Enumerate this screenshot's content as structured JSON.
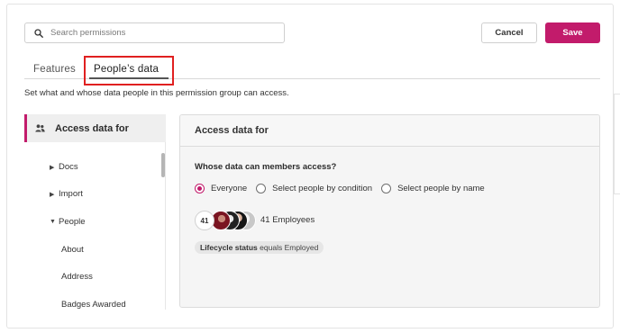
{
  "search": {
    "placeholder": "Search permissions"
  },
  "actions": {
    "cancel_label": "Cancel",
    "save_label": "Save"
  },
  "tabs": [
    {
      "label": "Features",
      "active": false
    },
    {
      "label": "People’s data",
      "active": true
    }
  ],
  "description": "Set what and whose data people in this permission group can access.",
  "sidebar": {
    "active_item": {
      "label": "Access data for",
      "icon": "people-icon"
    },
    "items": [
      {
        "label": "Docs",
        "caret": "right"
      },
      {
        "label": "Import",
        "caret": "right"
      },
      {
        "label": "People",
        "caret": "down"
      },
      {
        "label": "About",
        "caret": ""
      },
      {
        "label": "Address",
        "caret": ""
      },
      {
        "label": "Badges Awarded",
        "caret": ""
      }
    ]
  },
  "panel": {
    "title": "Access data for",
    "question": "Whose data can members access?",
    "options": [
      {
        "label": "Everyone",
        "selected": true
      },
      {
        "label": "Select people by condition",
        "selected": false
      },
      {
        "label": "Select people by name",
        "selected": false
      }
    ],
    "avatar_count": "41",
    "employees_label": "41 Employees",
    "filter": {
      "field": "Lifecycle status",
      "rest": "equals Employed"
    }
  },
  "colors": {
    "accent": "#c21b6b",
    "highlight": "#e02020"
  }
}
